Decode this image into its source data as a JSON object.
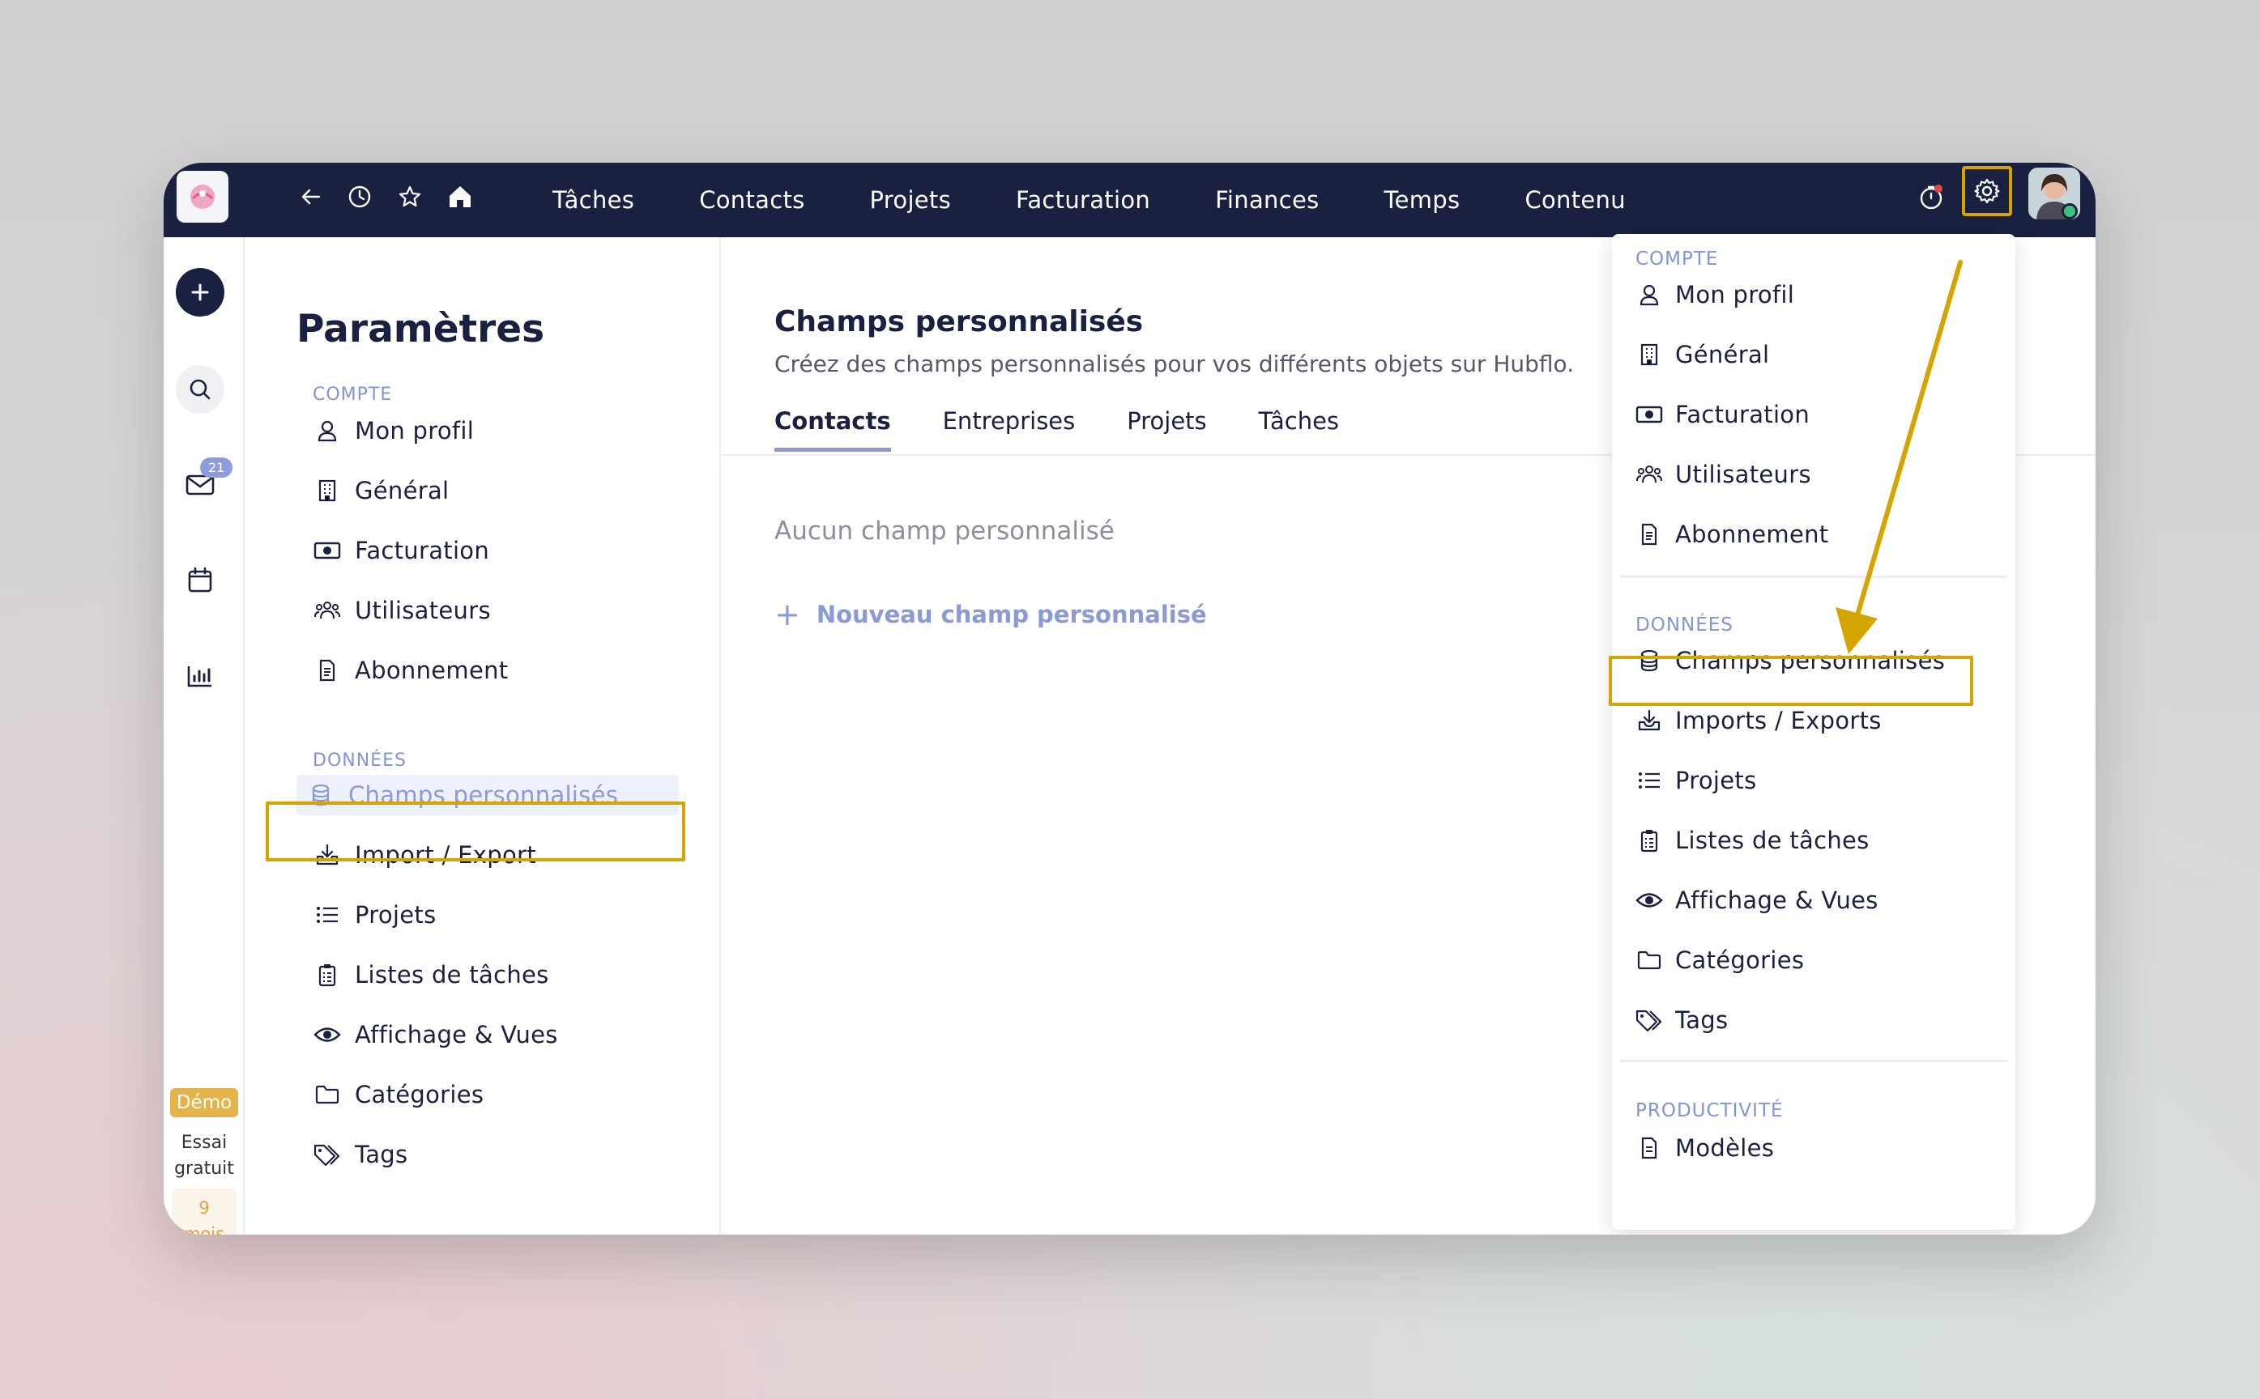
{
  "topbar": {
    "nav": [
      "Tâches",
      "Contacts",
      "Projets",
      "Facturation",
      "Finances",
      "Temps",
      "Contenu"
    ]
  },
  "rail": {
    "mail_badge": "21",
    "demo_label": "Démo",
    "trial_line1": "Essai",
    "trial_line2": "gratuit",
    "months_num": "9",
    "months_label": "mois"
  },
  "settings": {
    "title": "Paramètres",
    "section_account": "COMPTE",
    "account_items": [
      "Mon profil",
      "Général",
      "Facturation",
      "Utilisateurs",
      "Abonnement"
    ],
    "section_data": "DONNÉES",
    "data_items": [
      "Champs personnalisés",
      "Import / Export",
      "Projets",
      "Listes de tâches",
      "Affichage & Vues",
      "Catégories",
      "Tags"
    ]
  },
  "main": {
    "title": "Champs personnalisés",
    "subtitle": "Créez des champs personnalisés pour vos différents objets sur Hubflo.",
    "tabs": [
      "Contacts",
      "Entreprises",
      "Projets",
      "Tâches"
    ],
    "empty_text": "Aucun champ personnalisé",
    "new_button": "Nouveau champ personnalisé"
  },
  "dropdown": {
    "section_account": "COMPTE",
    "account_items": [
      "Mon profil",
      "Général",
      "Facturation",
      "Utilisateurs",
      "Abonnement"
    ],
    "section_data": "DONNÉES",
    "data_items": [
      "Champs personnalisés",
      "Imports / Exports",
      "Projets",
      "Listes de tâches",
      "Affichage & Vues",
      "Catégories",
      "Tags"
    ],
    "section_productivity": "PRODUCTIVITÉ",
    "productivity_items": [
      "Modèles"
    ]
  },
  "colors": {
    "topbar": "#1a2040",
    "accent": "#8a9ad4",
    "highlight": "#d4a500",
    "demo": "#e4b44a"
  }
}
